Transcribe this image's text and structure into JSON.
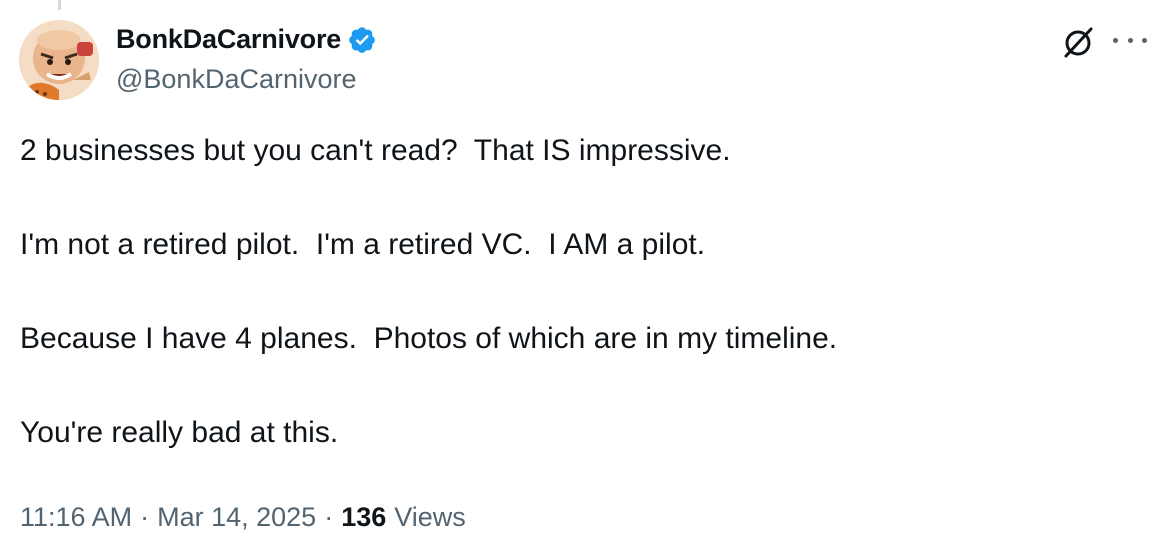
{
  "author": {
    "display_name": "BonkDaCarnivore",
    "handle": "@BonkDaCarnivore",
    "verified": true,
    "verified_color": "#1d9bf0"
  },
  "tweet": {
    "paragraphs": [
      "2 businesses but you can't read?  That IS impressive.",
      "I'm not a retired pilot.  I'm a retired VC.  I AM a pilot.",
      "Because I have 4 planes.  Photos of which are in my timeline.",
      "You're really bad at this."
    ]
  },
  "meta": {
    "time": "11:16 AM",
    "separator": "·",
    "date": "Mar 14, 2025",
    "views_count": "136",
    "views_label": "Views"
  },
  "icons": {
    "grok": "grok-icon",
    "more": "more-icon",
    "verified": "verified-badge-icon"
  }
}
